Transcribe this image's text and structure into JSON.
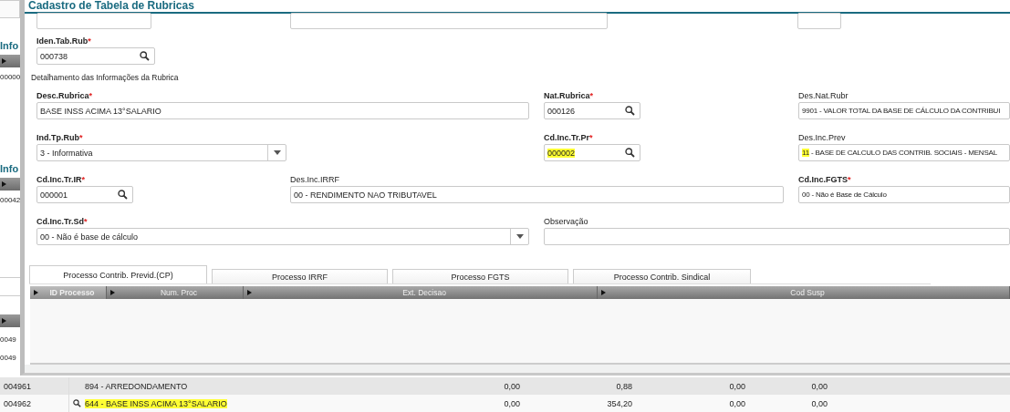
{
  "background": {
    "panels": [
      {
        "heading": "Info",
        "cell": "00000"
      },
      {
        "heading": "Info",
        "cell": "00042"
      }
    ],
    "list_cells": [
      "0049",
      "0049"
    ],
    "rows": [
      {
        "shaded": true,
        "lookup": false,
        "highlighted": false,
        "cells": [
          "004961",
          "894 - ARREDONDAMENTO",
          "0,00",
          "0,88",
          "0,00",
          "0,00"
        ]
      },
      {
        "shaded": false,
        "lookup": true,
        "highlighted": true,
        "cells": [
          "004962",
          "644 - BASE INSS ACIMA 13°SALARIO",
          "0,00",
          "354,20",
          "0,00",
          "0,00"
        ]
      }
    ]
  },
  "dialog": {
    "title": "Cadastro de Tabela de Rubricas",
    "required_marker": "*",
    "first_field": {
      "kind": "lookup",
      "label": "Iden.Tab.Rub",
      "required": true,
      "value_parts": [
        {
          "text": "000738",
          "highlighted": false
        }
      ]
    },
    "section_title": "Detalhamento das Informações da Rubrica",
    "field_rows": [
      [
        {
          "kind": "text",
          "label": "Desc.Rubrica",
          "required": true,
          "value_parts": [
            {
              "text": "BASE INSS ACIMA 13°SALARIO",
              "highlighted": false
            }
          ]
        },
        {
          "kind": "lookup",
          "label": "Nat.Rubrica",
          "required": true,
          "value_parts": [
            {
              "text": "000126",
              "highlighted": false
            }
          ]
        },
        {
          "kind": "text",
          "label": "Des.Nat.Rubr",
          "required": false,
          "value_parts": [
            {
              "text": "9901 - VALOR TOTAL DA BASE DE CÁLCULO DA CONTRIBUI",
              "highlighted": false
            }
          ]
        }
      ],
      [
        {
          "kind": "select",
          "label": "Ind.Tp.Rub",
          "required": true,
          "value_parts": [
            {
              "text": "3 - Informativa",
              "highlighted": false
            }
          ]
        },
        {
          "kind": "lookup",
          "label": "Cd.Inc.Tr.Pr",
          "required": true,
          "value_parts": [
            {
              "text": "000002",
              "highlighted": true
            }
          ]
        },
        {
          "kind": "text",
          "label": "Des.Inc.Prev",
          "required": false,
          "value_parts": [
            {
              "text": "11",
              "highlighted": true
            },
            {
              "text": " - BASE DE CALCULO DAS CONTRIB. SOCIAIS - MENSAL",
              "highlighted": false
            }
          ]
        }
      ],
      [
        {
          "kind": "lookup",
          "label": "Cd.Inc.Tr.IR",
          "required": true,
          "value_parts": [
            {
              "text": "000001",
              "highlighted": false
            }
          ]
        },
        {
          "kind": "text",
          "label": "Des.Inc.IRRF",
          "required": false,
          "value_parts": [
            {
              "text": "00 - RENDIMENTO NAO TRIBUTAVEL",
              "highlighted": false
            }
          ]
        },
        {
          "kind": "text",
          "label": "Cd.Inc.FGTS",
          "required": true,
          "value_parts": [
            {
              "text": "00 - Não é Base de Cálculo",
              "highlighted": false
            }
          ]
        }
      ],
      [
        {
          "kind": "select",
          "label": "Cd.Inc.Tr.Sd",
          "required": true,
          "value_parts": [
            {
              "text": "00 - Não é base de cálculo",
              "highlighted": false
            }
          ]
        },
        {
          "kind": "text",
          "label": "Observação",
          "required": false
        }
      ]
    ],
    "tabs": [
      {
        "label": "Processo Contrib. Previd.(CP)",
        "selected": true
      },
      {
        "label": "Processo IRRF",
        "selected": false
      },
      {
        "label": "Processo FGTS",
        "selected": false
      },
      {
        "label": "Processo Contrib. Sindical",
        "selected": false
      }
    ],
    "grid_columns": [
      {
        "label": "ID Processo",
        "selected": true
      },
      {
        "label": "Num. Proc",
        "selected": false
      },
      {
        "label": "Ext. Decisao",
        "selected": false
      },
      {
        "label": "Cod Susp",
        "selected": false
      }
    ]
  }
}
